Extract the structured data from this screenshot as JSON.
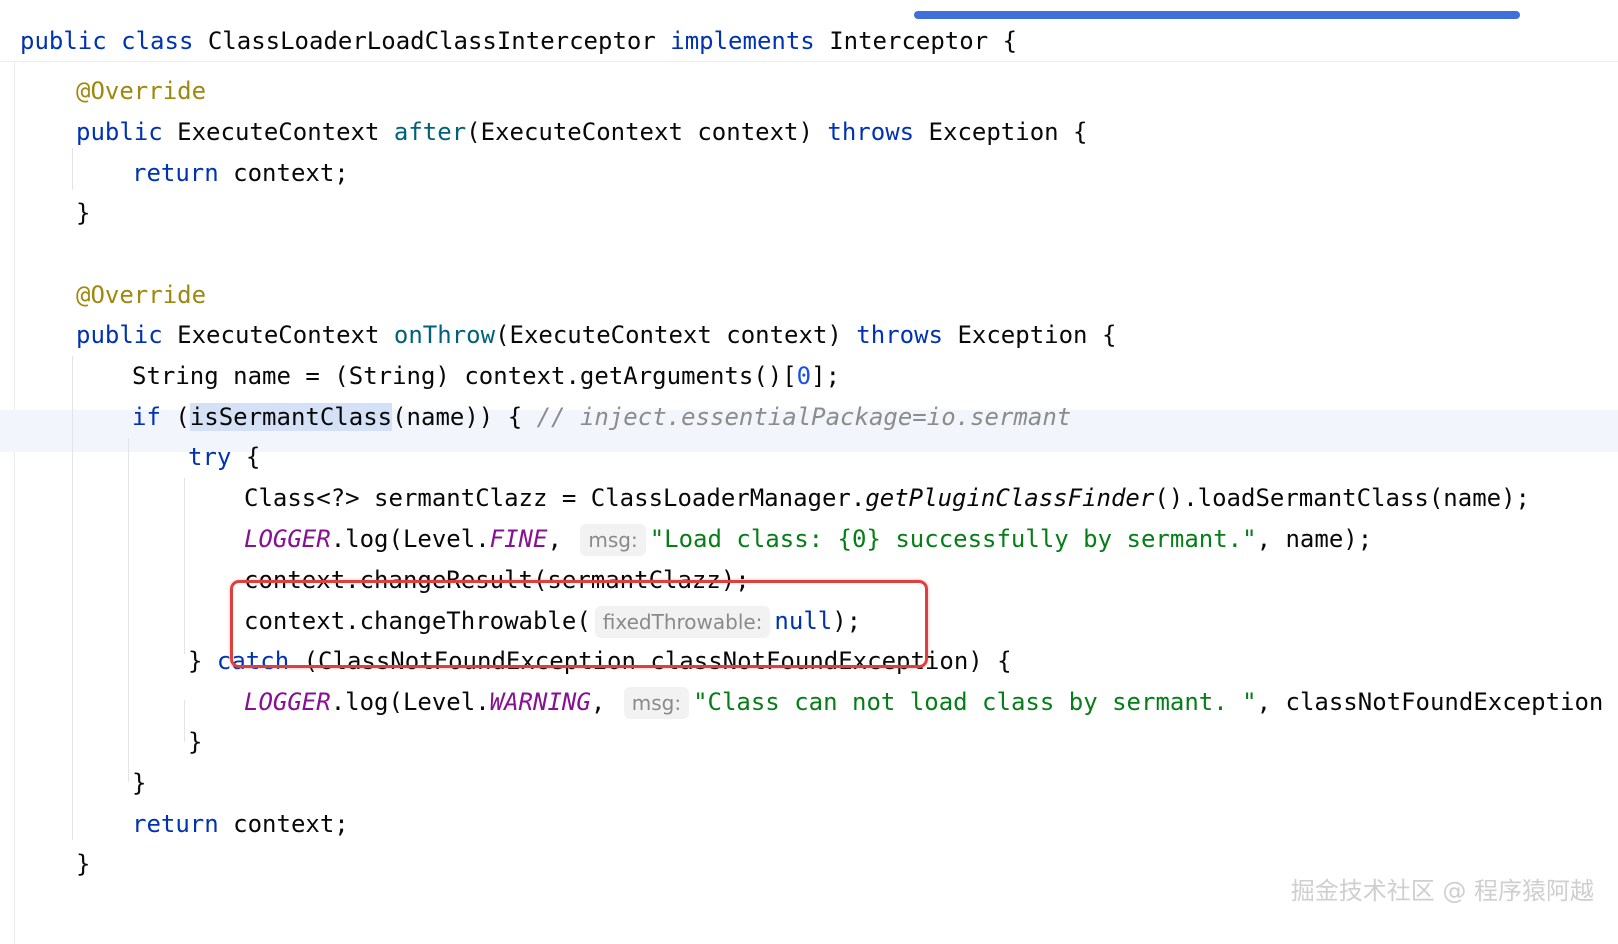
{
  "colors": {
    "keyword": "#0033b3",
    "annotation": "#9e880d",
    "method": "#00627a",
    "string": "#067d17",
    "comment": "#8c8c8c",
    "constant": "#871094",
    "number": "#1750eb",
    "highlight_border": "#e0403d",
    "scrollbar": "#3f6fd8"
  },
  "code": {
    "l1": {
      "kw_public": "public",
      "kw_class": "class",
      "class_name": "ClassLoaderLoadClassInterceptor",
      "kw_implements": "implements",
      "iface": "Interceptor",
      "brace": "{"
    },
    "l2": {
      "annotation": "@Override"
    },
    "l3": {
      "kw_public": "public",
      "ret_type": "ExecuteContext",
      "method": "after",
      "params": "(ExecuteContext context)",
      "kw_throws": "throws",
      "exc": "Exception {"
    },
    "l4": {
      "kw_return": "return",
      "rest": "context;"
    },
    "l5": {
      "brace": "}"
    },
    "l6": {
      "annotation": "@Override"
    },
    "l7": {
      "kw_public": "public",
      "ret_type": "ExecuteContext",
      "method": "onThrow",
      "params": "(ExecuteContext context)",
      "kw_throws": "throws",
      "exc": "Exception {"
    },
    "l8": {
      "pre": "String name = (String) context.getArguments()[",
      "num": "0",
      "post": "];"
    },
    "l9": {
      "kw_if": "if",
      "paren": "(",
      "method": "isSermantClass",
      "rest": "(name)) {",
      "comment": "// inject.essentialPackage=io.sermant"
    },
    "l10": {
      "kw_try": "try",
      "rest": "{"
    },
    "l11": {
      "pre": "Class<?> sermantClazz = ClassLoaderManager.",
      "method": "getPluginClassFinder",
      "post": "().loadSermantClass(name);"
    },
    "l12": {
      "logger": "LOGGER",
      "mid": ".log(Level.",
      "level": "FINE",
      "comma": ",",
      "hint": "msg:",
      "str": "\"Load class: {0} successfully by sermant.\"",
      "post": ", name);"
    },
    "l13": {
      "text": "context.changeResult(sermantClazz);"
    },
    "l14": {
      "pre": "context.changeThrowable(",
      "hint": "fixedThrowable:",
      "kw_null": "null",
      "post": ");"
    },
    "l15": {
      "brace": "}",
      "kw_catch": "catch",
      "rest": "(ClassNotFoundException classNotFoundException) {"
    },
    "l16": {
      "logger": "LOGGER",
      "mid": ".log(Level.",
      "level": "WARNING",
      "comma": ",",
      "hint": "msg:",
      "str": "\"Class can not load class by sermant. \"",
      "post": ", classNotFoundException"
    },
    "l17": {
      "brace": "}"
    },
    "l18": {
      "brace": "}"
    },
    "l19": {
      "kw_return": "return",
      "rest": "context;"
    },
    "l20": {
      "brace": "}"
    }
  },
  "watermark": "掘金技术社区 @ 程序猿阿越"
}
